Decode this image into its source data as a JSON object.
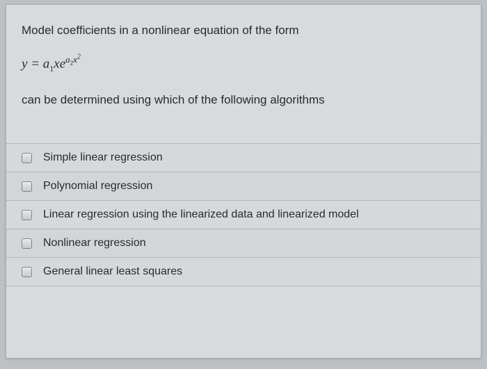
{
  "question": {
    "line1": "Model coefficients in a nonlinear equation of the form",
    "equation": {
      "lhs": "y",
      "eq": " = ",
      "a1": "a",
      "a1sub": "1",
      "x1": "x",
      "e": "e",
      "exp_a2": "a",
      "exp_a2sub": "2",
      "exp_x": "x",
      "exp_pow": "2"
    },
    "line2": "can be determined using which of the following algorithms"
  },
  "options": [
    {
      "label": "Simple linear regression",
      "checked": false
    },
    {
      "label": "Polynomial regression",
      "checked": false
    },
    {
      "label": "Linear regression using the linearized data and linearized model",
      "checked": false
    },
    {
      "label": "Nonlinear regression",
      "checked": false
    },
    {
      "label": "General linear least squares",
      "checked": false
    }
  ]
}
